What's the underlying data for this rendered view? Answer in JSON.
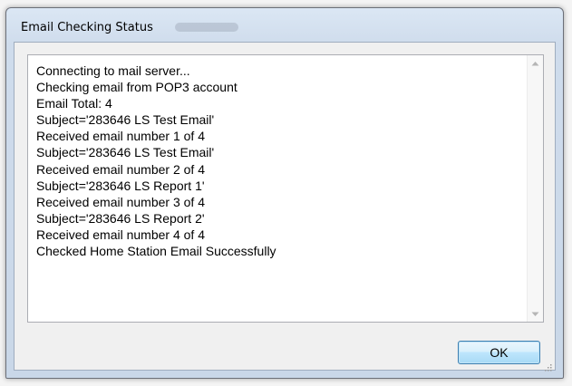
{
  "window": {
    "title": "Email Checking Status"
  },
  "log": {
    "lines": [
      "Connecting to mail server...",
      "Checking email from POP3 account",
      "Email Total: 4",
      "Subject='283646 LS Test Email'",
      "Received email number 1 of 4",
      "Subject='283646 LS Test Email'",
      "Received email number 2 of 4",
      "Subject='283646 LS Report 1'",
      "Received email number 3 of 4",
      "Subject='283646 LS Report 2'",
      "Received email number 4 of 4",
      "Checked Home Station Email Successfully"
    ]
  },
  "buttons": {
    "ok_label": "OK"
  },
  "icons": {
    "scroll_up": "scroll-up-arrow-icon",
    "scroll_down": "scroll-down-arrow-icon",
    "resize_grip": "resize-grip-icon"
  },
  "colors": {
    "window_frame": "#cfdcec",
    "button_accent": "#3c7fb1"
  }
}
